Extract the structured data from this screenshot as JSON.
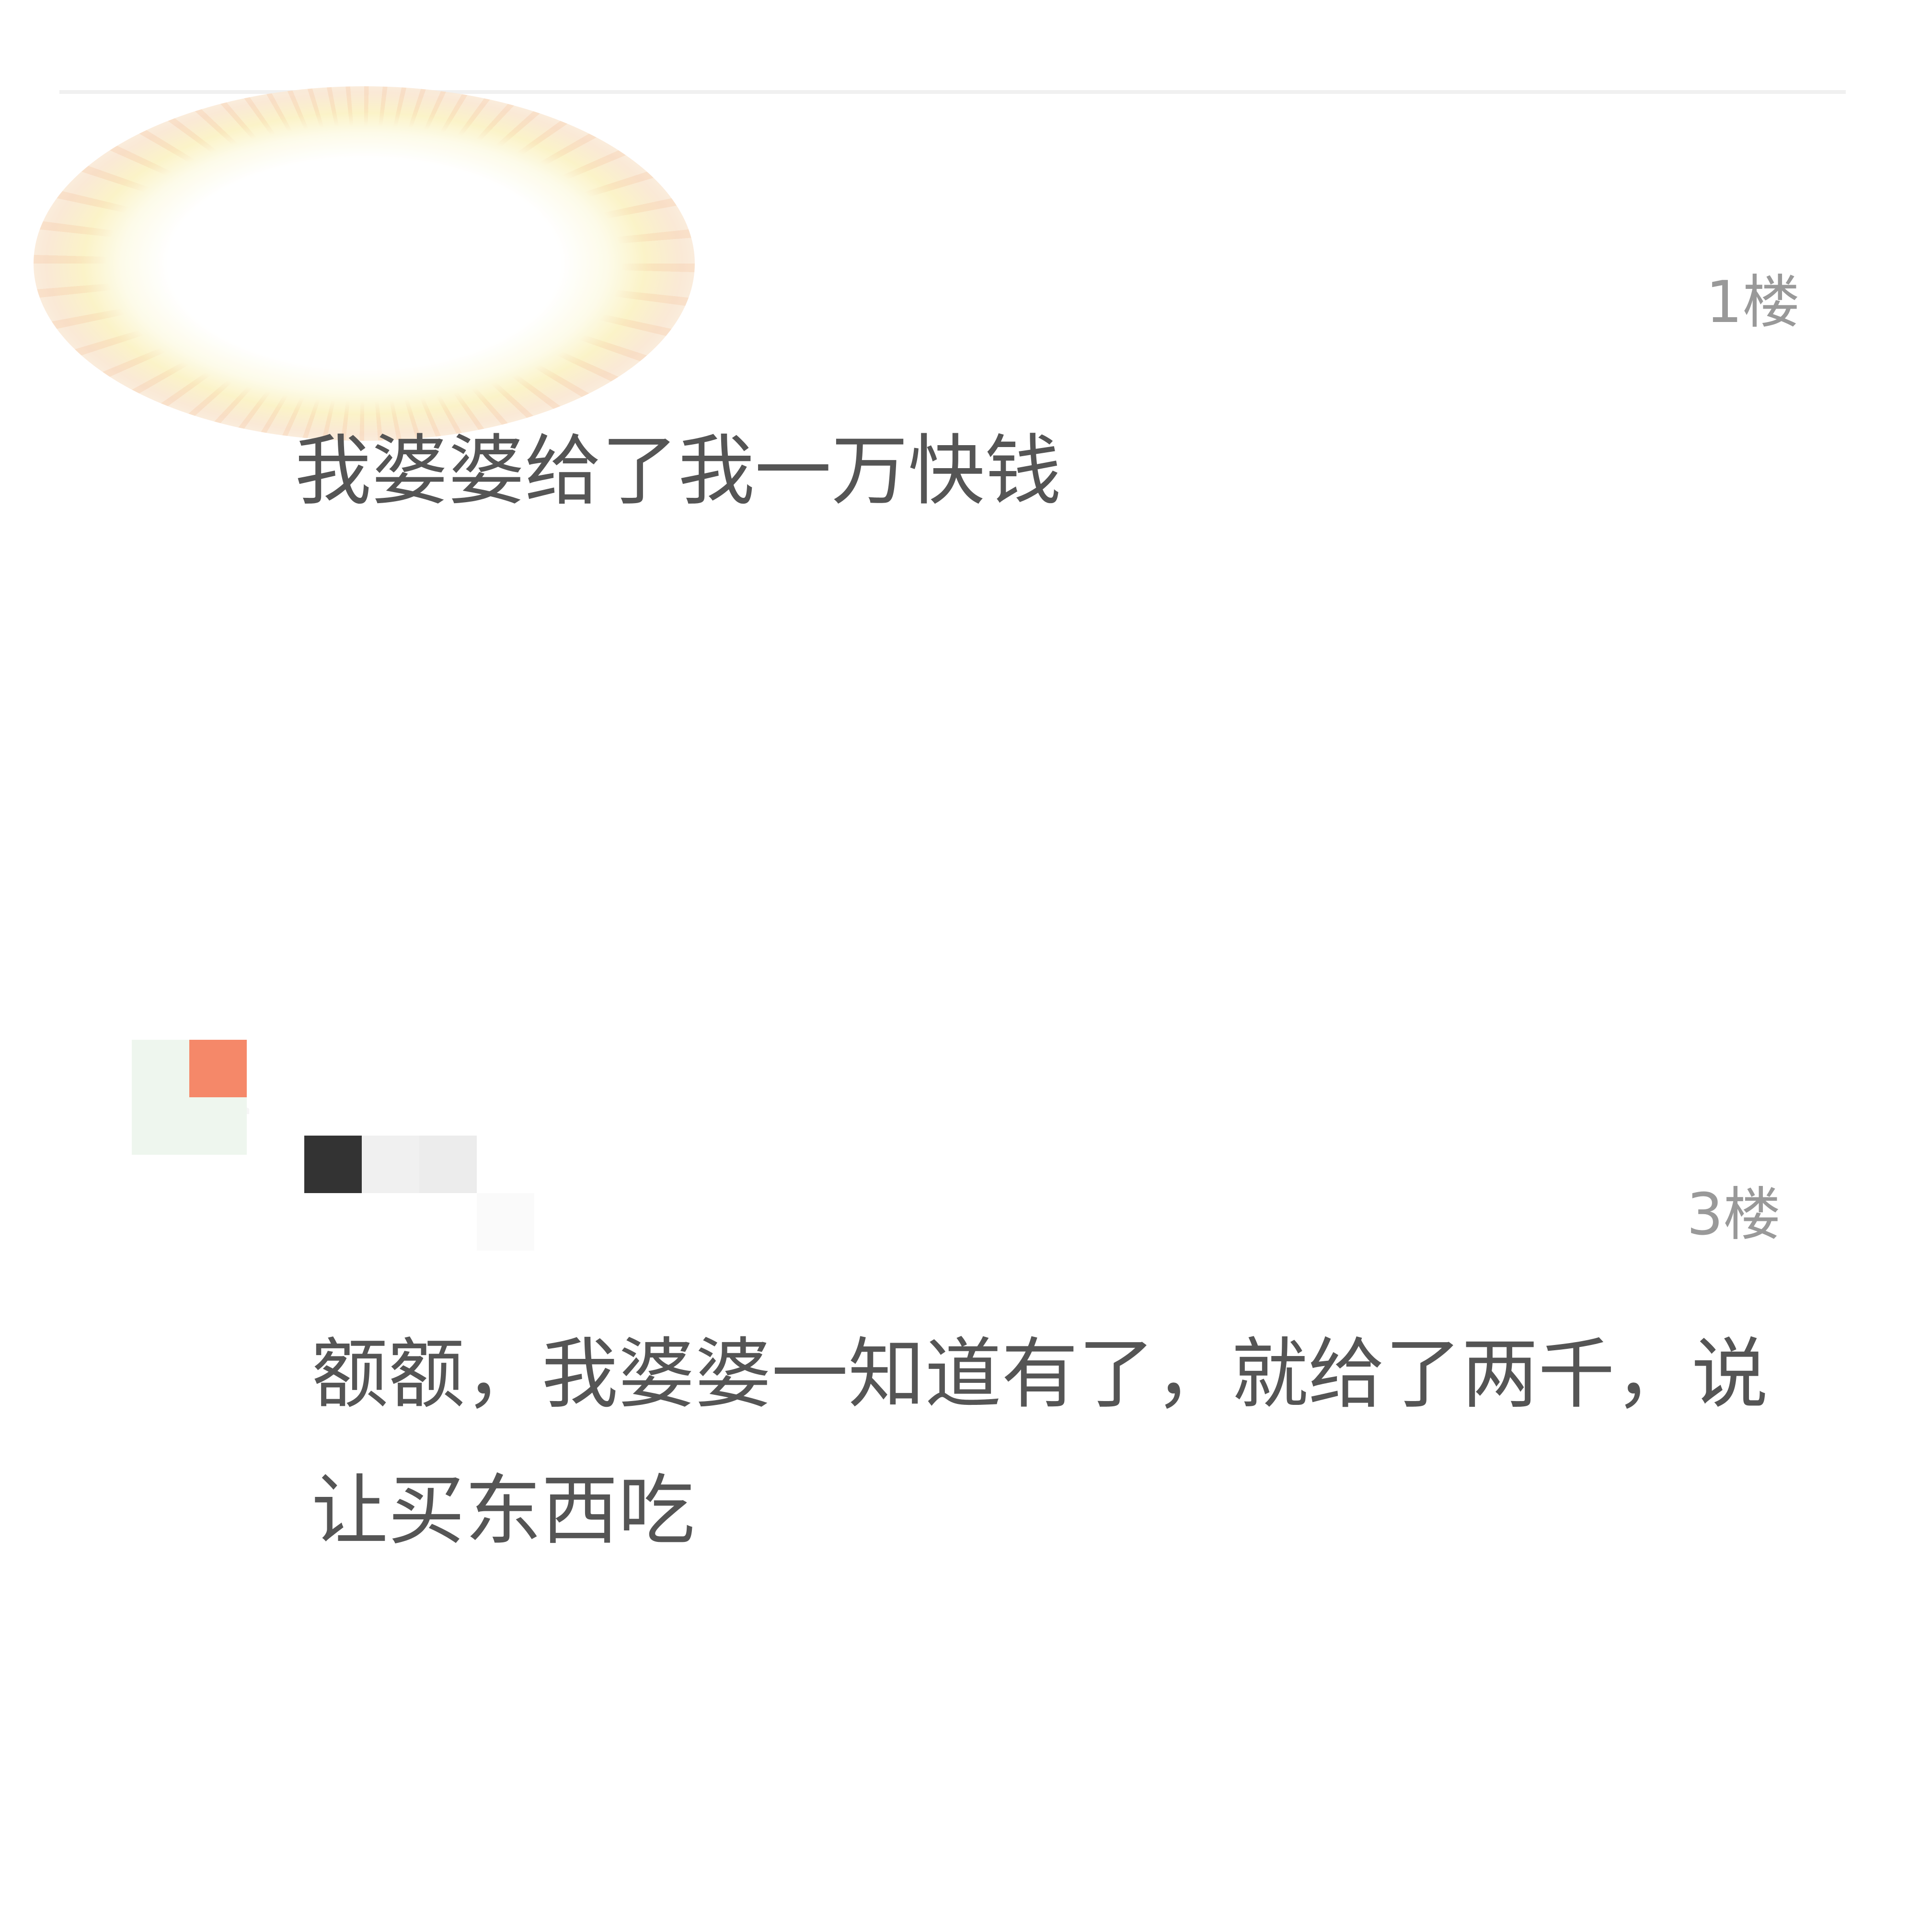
{
  "thread": {
    "replies": [
      {
        "floor": "1楼",
        "content": "我婆婆给了我一万快钱"
      },
      {
        "floor": "3楼",
        "content": "额额，我婆婆一知道有了，就给了两千，说让买东西吃"
      }
    ]
  },
  "colors": {
    "background": "#ffffff",
    "divider": "#f0f0f0",
    "floor_label": "#999999",
    "comment_text": "#555555",
    "avatar_accent": "#f58869"
  }
}
